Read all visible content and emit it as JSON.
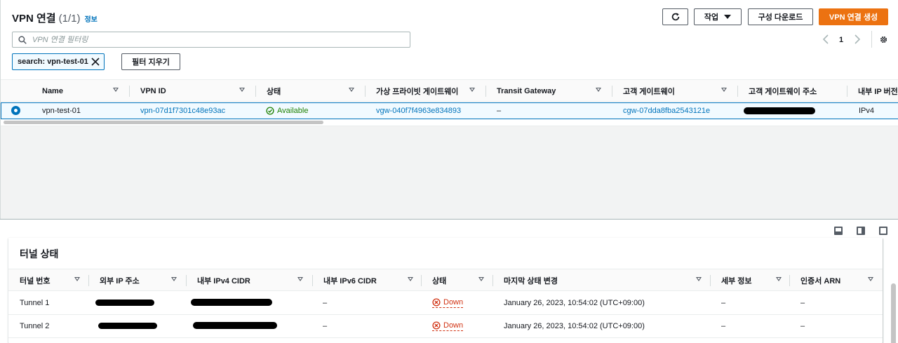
{
  "header": {
    "title": "VPN 연결",
    "count": "(1/1)",
    "info": "정보",
    "actions_label": "작업",
    "download_label": "구성 다운로드",
    "create_label": "VPN 연결 생성"
  },
  "filter": {
    "placeholder": "VPN 연결 필터링",
    "token": "search: vpn-test-01",
    "clear_label": "필터 지우기"
  },
  "pagination": {
    "page": "1"
  },
  "table": {
    "columns": [
      "Name",
      "VPN ID",
      "상태",
      "가상 프라이빗 게이트웨이",
      "Transit Gateway",
      "고객 게이트웨이",
      "고객 게이트웨이 주소",
      "내부 IP 버전"
    ],
    "row": {
      "name": "vpn-test-01",
      "vpn_id": "vpn-07d1f7301c48e93ac",
      "state": "Available",
      "vgw": "vgw-040f7f4963e834893",
      "tgw": "–",
      "cgw": "cgw-07dda8fba2543121e",
      "ip_version": "IPv4"
    }
  },
  "tunnels": {
    "title": "터널 상태",
    "columns": [
      "터널 번호",
      "외부 IP 주소",
      "내부 IPv4 CIDR",
      "내부 IPv6 CIDR",
      "상태",
      "마지막 상태 변경",
      "세부 정보",
      "인증서 ARN"
    ],
    "rows": [
      {
        "name": "Tunnel 1",
        "ipv6": "–",
        "status": "Down",
        "changed": "January 26, 2023, 10:54:02 (UTC+09:00)",
        "details": "–",
        "arn": "–"
      },
      {
        "name": "Tunnel 2",
        "ipv6": "–",
        "status": "Down",
        "changed": "January 26, 2023, 10:54:02 (UTC+09:00)",
        "details": "–",
        "arn": "–"
      }
    ]
  },
  "colors": {
    "accent": "#0073bb",
    "primary": "#ec7211",
    "ok": "#1d8102",
    "error": "#d13212"
  },
  "icons": [
    "refresh-icon",
    "caret-down-icon",
    "search-icon",
    "close-icon",
    "chevron-left-icon",
    "chevron-right-icon",
    "gear-icon",
    "check-circle-icon",
    "error-circle-icon"
  ]
}
